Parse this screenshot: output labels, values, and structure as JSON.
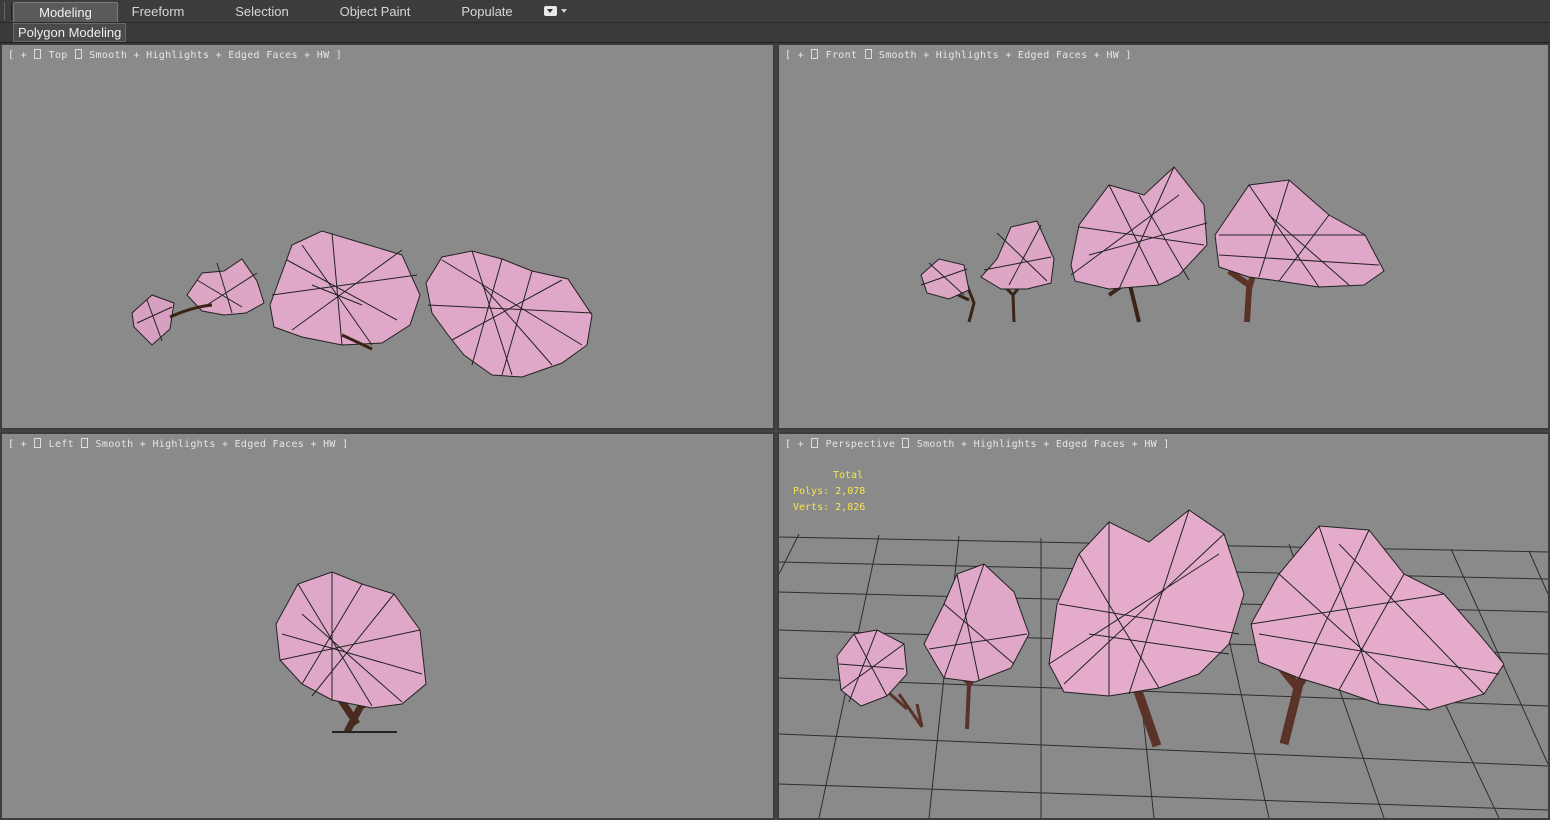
{
  "ribbon": {
    "tabs": [
      "Modeling",
      "Freeform",
      "Selection",
      "Object Paint",
      "Populate"
    ],
    "active_tab": "Modeling",
    "panel_label": "Polygon Modeling"
  },
  "viewports": {
    "top": {
      "label": [
        "[ + ",
        " Top ",
        " Smooth + Highlights + Edged Faces + HW ]"
      ]
    },
    "front": {
      "label": [
        "[ + ",
        " Front ",
        " Smooth + Highlights + Edged Faces + HW ]"
      ]
    },
    "left": {
      "label": [
        "[ + ",
        " Left ",
        " Smooth + Highlights + Edged Faces + HW ]"
      ]
    },
    "persp": {
      "label": [
        "[ + ",
        " Perspective ",
        " Smooth + Highlights + Edged Faces + HW ]"
      ],
      "stats": {
        "title": "Total",
        "polys_label": "Polys:",
        "polys": "2,078",
        "verts_label": "Verts:",
        "verts": "2,826"
      }
    }
  },
  "colors": {
    "viewport_bg": "#8a8a8a",
    "stats_text": "#f5e64a",
    "blossom": "#e2a8c8",
    "trunk": "#6a3a2a"
  }
}
